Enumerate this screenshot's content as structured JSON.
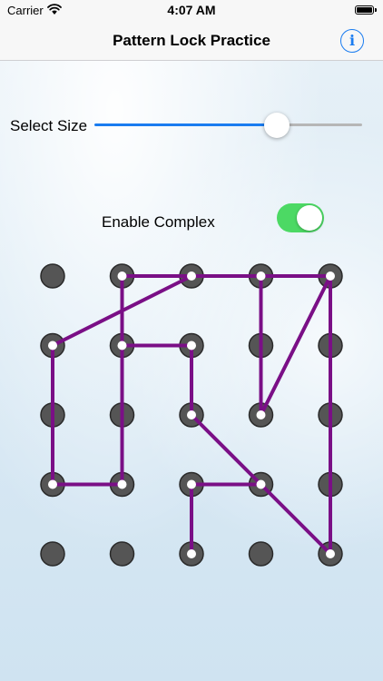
{
  "status_bar": {
    "carrier": "Carrier",
    "time": "4:07 AM"
  },
  "nav": {
    "title": "Pattern Lock Practice",
    "info_icon": "info-icon",
    "info_glyph": "i"
  },
  "controls": {
    "size_label": "Select Size",
    "size_slider_fraction": 0.68,
    "complex_label": "Enable Complex",
    "complex_enabled": true
  },
  "colors": {
    "accent": "#1a7cf0",
    "toggle_on": "#4cd964",
    "pattern_line": "#7a0f86",
    "dot_fill": "#555555",
    "dot_border": "#2a2a2a"
  },
  "pattern": {
    "columns": 5,
    "rows": 5,
    "path": [
      [
        4,
        0
      ],
      [
        1,
        0
      ],
      [
        1,
        3
      ],
      [
        0,
        3
      ],
      [
        0,
        1
      ],
      [
        2,
        0
      ],
      [
        3,
        0
      ],
      [
        3,
        2
      ],
      [
        4,
        0
      ],
      [
        4,
        4
      ],
      [
        3,
        3
      ],
      [
        2,
        2
      ],
      [
        2,
        1
      ],
      [
        1,
        1
      ]
    ],
    "extra_path": [
      [
        3,
        3
      ],
      [
        2,
        3
      ],
      [
        2,
        4
      ]
    ]
  }
}
